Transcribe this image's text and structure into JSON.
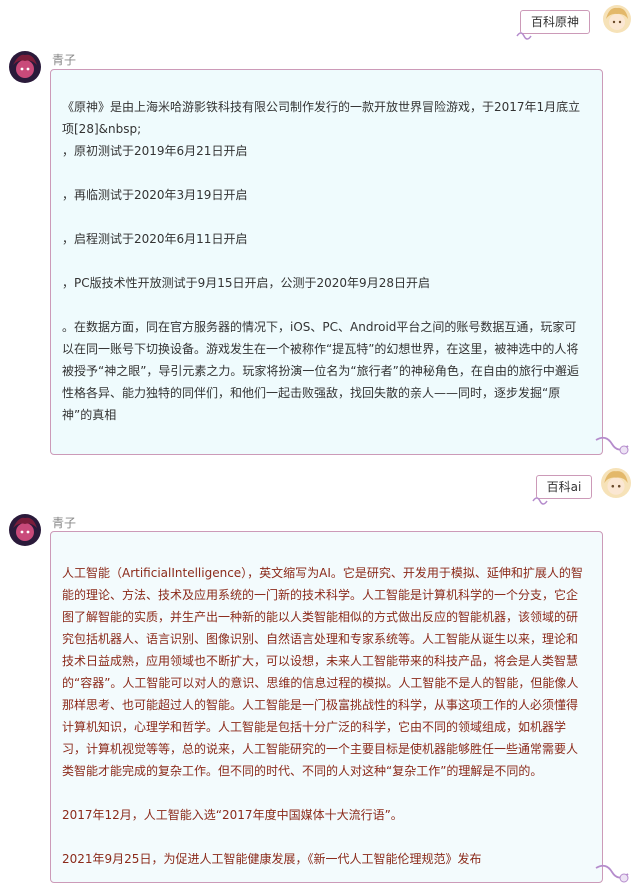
{
  "messages": [
    {
      "role": "user",
      "text": "百科原神"
    },
    {
      "role": "assistant",
      "sender": "青子",
      "paragraphs": [
        "《原神》是由上海米哈游影铁科技有限公司制作发行的一款开放世界冒险游戏，于2017年1月底立项[28]&nbsp;\n，原初测试于2019年6月21日开启",
        "，再临测试于2020年3月19日开启",
        "，启程测试于2020年6月11日开启",
        "，PC版技术性开放测试于9月15日开启，公测于2020年9月28日开启",
        "。在数据方面，同在官方服务器的情况下，iOS、PC、Android平台之间的账号数据互通，玩家可以在同一账号下切换设备。游戏发生在一个被称作“提瓦特”的幻想世界，在这里，被神选中的人将被授予“神之眼”，导引元素之力。玩家将扮演一位名为“旅行者”的神秘角色，在自由的旅行中邂逅性格各异、能力独特的同伴们，和他们一起击败强敌，找回失散的亲人——同时，逐步发掘“原神”的真相"
      ]
    },
    {
      "role": "user",
      "text": "百科ai"
    },
    {
      "role": "assistant",
      "sender": "青子",
      "paragraphs": [
        "人工智能（ArtificialIntelligence），英文缩写为AI。它是研究、开发用于模拟、延伸和扩展人的智能的理论、方法、技术及应用系统的一门新的技术科学。人工智能是计算机科学的一个分支，它企图了解智能的实质，并生产出一种新的能以人类智能相似的方式做出反应的智能机器，该领域的研究包括机器人、语言识别、图像识别、自然语言处理和专家系统等。人工智能从诞生以来，理论和技术日益成熟，应用领域也不断扩大，可以设想，未来人工智能带来的科技产品，将会是人类智慧的“容器”。人工智能可以对人的意识、思维的信息过程的模拟。人工智能不是人的智能，但能像人那样思考、也可能超过人的智能。人工智能是一门极富挑战性的科学，从事这项工作的人必须懂得计算机知识，心理学和哲学。人工智能是包括十分广泛的科学，它由不同的领域组成，如机器学习，计算机视觉等等，总的说来，人工智能研究的一个主要目标是使机器能够胜任一些通常需要人类智能才能完成的复杂工作。但不同的时代、不同的人对这种“复杂工作”的理解是不同的。",
        "2017年12月，人工智能入选“2017年度中国媒体十大流行语”。",
        "2021年9月25日，为促进人工智能健康发展，《新一代人工智能伦理规范》发布"
      ]
    }
  ]
}
